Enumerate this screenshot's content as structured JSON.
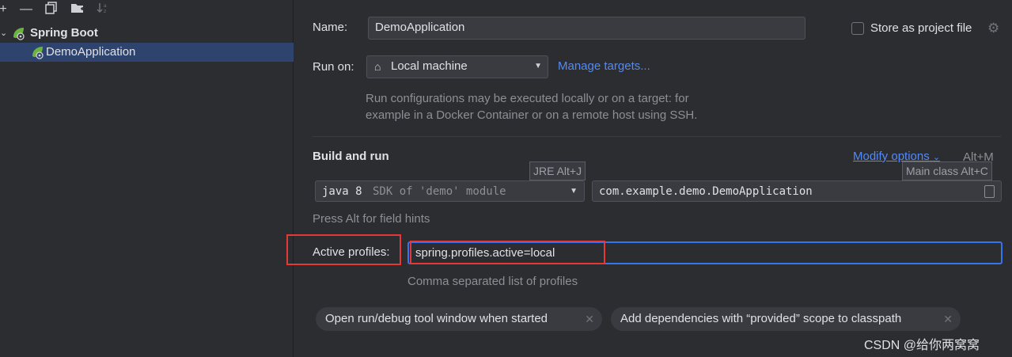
{
  "tree": {
    "group_label": "Spring Boot",
    "item_label": "DemoApplication"
  },
  "form": {
    "name_label": "Name:",
    "name_value": "DemoApplication",
    "store_label": "Store as project file",
    "run_on_label": "Run on:",
    "run_on_value": "Local machine",
    "manage_targets": "Manage targets...",
    "run_on_hint_line1": "Run configurations may be executed locally or on a target: for",
    "run_on_hint_line2": "example in a Docker Container or on a remote host using SSH.",
    "build_section": "Build and run",
    "modify_options": "Modify options",
    "modify_shortcut": "Alt+M",
    "jre_tooltip": "JRE Alt+J",
    "main_class_tooltip": "Main class Alt+C",
    "sdk_java": "java 8",
    "sdk_desc": "SDK of 'demo' module",
    "main_class_value": "com.example.demo.DemoApplication",
    "alt_hint": "Press Alt for field hints",
    "active_profiles_label": "Active profiles:",
    "active_profiles_value": "spring.profiles.active=local",
    "profiles_hint": "Comma separated list of profiles",
    "tag1": "Open run/debug tool window when started",
    "tag2": "Add dependencies with “provided” scope to classpath"
  },
  "watermark": "CSDN @给你两窝窝",
  "colors": {
    "accent_link": "#548af7",
    "selection": "#2e436e",
    "highlight_box": "#e53935",
    "spring_green": "#6db33f"
  }
}
